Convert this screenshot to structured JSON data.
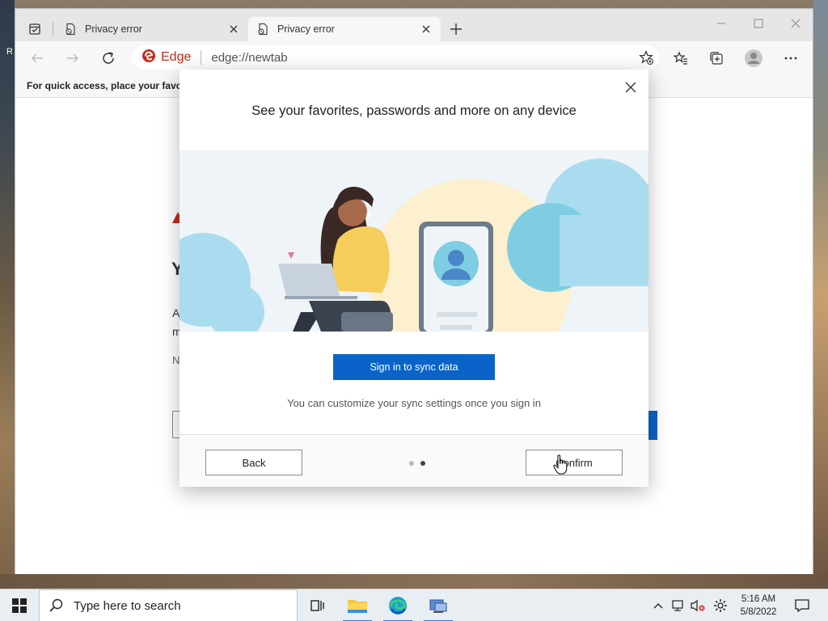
{
  "browser": {
    "tabs": [
      {
        "title": "Privacy error"
      },
      {
        "title": "Privacy error"
      }
    ],
    "address": {
      "site_label": "Edge",
      "url": "edge://newtab"
    },
    "favorites_bar_text": "For quick access, place your favorit"
  },
  "background_page": {
    "frag_y": "Y",
    "frag_a": "A",
    "frag_m": "m",
    "frag_n": "N",
    "frag_r": "R"
  },
  "dialog": {
    "title": "See your favorites, passwords and more on any device",
    "sign_in_button": "Sign in to sync data",
    "note": "You can customize your sync settings once you sign in",
    "back_button": "Back",
    "confirm_button": "Confirm",
    "pager": {
      "total": 2,
      "current": 2
    },
    "primary_color": "#0a64c8"
  },
  "taskbar": {
    "search_placeholder": "Type here to search",
    "time": "5:16 AM",
    "date": "5/8/2022"
  },
  "icons": [
    "tab-actions-icon",
    "page-icon",
    "close-icon",
    "plus-icon",
    "minimize-icon",
    "maximize-icon",
    "back-arrow-icon",
    "forward-arrow-icon",
    "refresh-icon",
    "edge-logo-icon",
    "add-favorite-icon",
    "favorites-icon",
    "collections-icon",
    "profile-icon",
    "more-icon",
    "windows-start-icon",
    "search-icon",
    "task-view-icon",
    "file-explorer-icon",
    "edge-icon",
    "network-app-icon",
    "chevron-up-icon",
    "network-icon",
    "volume-muted-icon",
    "settings-icon",
    "notifications-icon"
  ]
}
